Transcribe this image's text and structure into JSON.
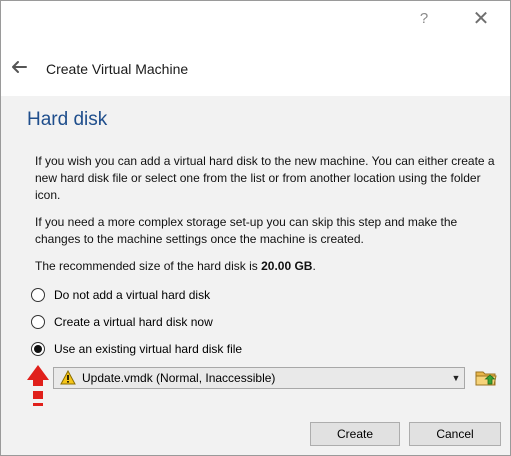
{
  "titlebar": {
    "help_glyph": "?",
    "close_glyph": "✕"
  },
  "wizard": {
    "title": "Create Virtual Machine"
  },
  "page": {
    "title": "Hard disk",
    "paragraph1": "If you wish you can add a virtual hard disk to the new machine. You can either create a new hard disk file or select one from the list or from another location using the folder icon.",
    "paragraph2": "If you need a more complex storage set-up you can skip this step and make the changes to the machine settings once the machine is created.",
    "recommended_prefix": "The recommended size of the hard disk is ",
    "recommended_size": "20.00 GB",
    "recommended_suffix": "."
  },
  "options": [
    {
      "label": "Do not add a virtual hard disk",
      "checked": false
    },
    {
      "label": "Create a virtual hard disk now",
      "checked": false
    },
    {
      "label": "Use an existing virtual hard disk file",
      "checked": true
    }
  ],
  "disk_select": {
    "value": "Update.vmdk (Normal, Inaccessible)",
    "icon": "warning-icon"
  },
  "buttons": {
    "create": "Create",
    "cancel": "Cancel"
  },
  "colors": {
    "title_blue": "#1f4e8c",
    "annotation_red": "#e0201b",
    "panel_bg": "#f2f2f2"
  }
}
